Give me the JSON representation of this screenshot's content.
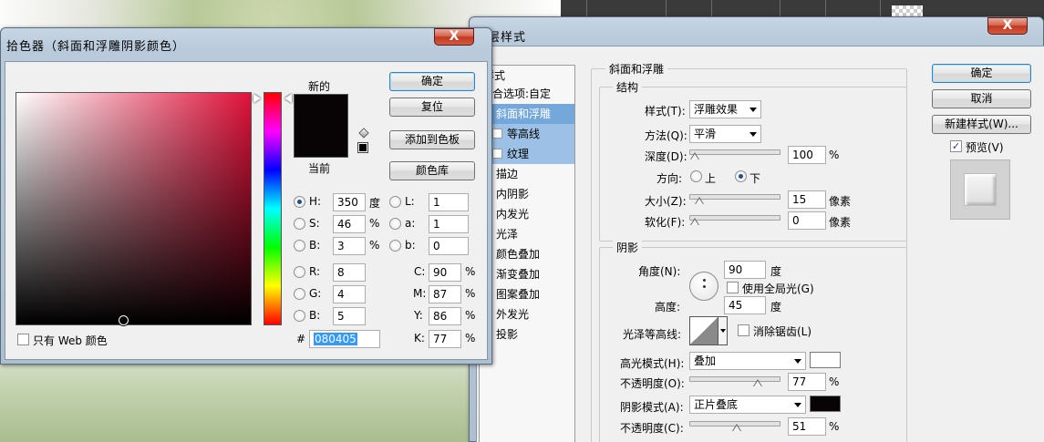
{
  "color_picker": {
    "title": "拾色器（斜面和浮雕阴影颜色）",
    "close_label": "X",
    "new_label": "新的",
    "current_label": "当前",
    "buttons": {
      "ok": "确定",
      "reset": "复位",
      "add_swatch": "添加到色板",
      "libraries": "颜色库"
    },
    "web_only_label": "只有 Web 颜色",
    "fields": {
      "H": {
        "label": "H:",
        "value": "350",
        "unit": "度"
      },
      "S": {
        "label": "S:",
        "value": "46",
        "unit": "%"
      },
      "Bv": {
        "label": "B:",
        "value": "3",
        "unit": "%"
      },
      "L": {
        "label": "L:",
        "value": "1"
      },
      "a": {
        "label": "a:",
        "value": "1"
      },
      "b": {
        "label": "b:",
        "value": "0"
      },
      "R": {
        "label": "R:",
        "value": "8"
      },
      "G": {
        "label": "G:",
        "value": "4"
      },
      "B2": {
        "label": "B:",
        "value": "5"
      },
      "C": {
        "label": "C:",
        "value": "90",
        "unit": "%"
      },
      "M": {
        "label": "M:",
        "value": "87",
        "unit": "%"
      },
      "Y": {
        "label": "Y:",
        "value": "86",
        "unit": "%"
      },
      "K": {
        "label": "K:",
        "value": "77",
        "unit": "%"
      }
    },
    "hex_label": "#",
    "hex_value": "080405",
    "new_color": "#080405",
    "current_color": "#080405",
    "hue_color": "#e0123a"
  },
  "layer_style": {
    "title": "图层样式",
    "title_visible": "层样式",
    "close_label": "X",
    "sidebar": {
      "header": "样式",
      "items": [
        {
          "label": "混合选项:自定",
          "has_check": false,
          "checked": false,
          "state": "normal"
        },
        {
          "label": "斜面和浮雕",
          "has_check": true,
          "checked": true,
          "state": "selected"
        },
        {
          "label": "等高线",
          "has_check": true,
          "checked": false,
          "state": "sub"
        },
        {
          "label": "纹理",
          "has_check": true,
          "checked": false,
          "state": "sub"
        },
        {
          "label": "描边",
          "has_check": true,
          "checked": false,
          "state": "normal"
        },
        {
          "label": "内阴影",
          "has_check": true,
          "checked": false,
          "state": "normal"
        },
        {
          "label": "内发光",
          "has_check": true,
          "checked": false,
          "state": "normal"
        },
        {
          "label": "光泽",
          "has_check": true,
          "checked": false,
          "state": "normal"
        },
        {
          "label": "颜色叠加",
          "has_check": true,
          "checked": false,
          "state": "normal"
        },
        {
          "label": "渐变叠加",
          "has_check": true,
          "checked": false,
          "state": "normal"
        },
        {
          "label": "图案叠加",
          "has_check": true,
          "checked": false,
          "state": "normal"
        },
        {
          "label": "外发光",
          "has_check": true,
          "checked": false,
          "state": "normal"
        },
        {
          "label": "投影",
          "has_check": true,
          "checked": false,
          "state": "normal"
        }
      ]
    },
    "bevel": {
      "group_title": "斜面和浮雕",
      "structure_title": "结构",
      "style_label": "样式(T):",
      "style_value": "浮雕效果",
      "technique_label": "方法(Q):",
      "technique_value": "平滑",
      "depth_label": "深度(D):",
      "depth_value": "100",
      "depth_unit": "%",
      "depth_level": 0.0,
      "direction_label": "方向:",
      "dir_up": "上",
      "dir_down": "下",
      "size_label": "大小(Z):",
      "size_value": "15",
      "size_unit": "像素",
      "size_level": 0.06,
      "soften_label": "软化(F):",
      "soften_value": "0",
      "soften_unit": "像素",
      "soften_level": 0.0
    },
    "shading": {
      "title": "阴影",
      "angle_label": "角度(N):",
      "angle_value": "90",
      "angle_unit": "度",
      "global_light_label": "使用全局光(G)",
      "altitude_label": "高度:",
      "altitude_value": "45",
      "altitude_unit": "度",
      "gloss_label": "光泽等高线:",
      "antialias_label": "消除锯齿(L)",
      "highlight_mode_label": "高光模式(H):",
      "highlight_mode_value": "叠加",
      "highlight_color": "#ffffff",
      "highlight_opacity_label": "不透明度(O):",
      "highlight_opacity_value": "77",
      "highlight_opacity_level": 0.77,
      "shadow_mode_label": "阴影模式(A):",
      "shadow_mode_value": "正片叠底",
      "shadow_color": "#080405",
      "shadow_opacity_label": "不透明度(C):",
      "shadow_opacity_value": "51",
      "shadow_opacity_level": 0.51,
      "pct": "%"
    },
    "buttons": {
      "ok": "确定",
      "cancel": "取消",
      "new_style": "新建样式(W)...",
      "preview": "预览(V)"
    }
  }
}
